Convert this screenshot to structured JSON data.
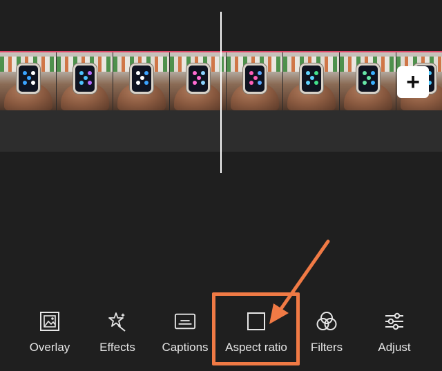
{
  "timeline": {
    "frames": [
      {
        "dots": [
          "#3aa3ff",
          "#ffffff"
        ]
      },
      {
        "dots": [
          "#4cc3ff",
          "#b56cff"
        ]
      },
      {
        "dots": [
          "#ffffff",
          "#3aa3ff"
        ]
      },
      {
        "dots": [
          "#ff6bd3",
          "#8ad2ff"
        ]
      },
      {
        "dots": [
          "#ff5fb8",
          "#5aa8ff"
        ]
      },
      {
        "dots": [
          "#5fd3ff",
          "#42e08a"
        ]
      },
      {
        "dots": [
          "#66e6a7",
          "#3bb0ff"
        ]
      },
      {
        "dots": [
          "#ff6be0",
          "#49c8ff"
        ]
      }
    ],
    "add_button": "+"
  },
  "toolbar": {
    "items": [
      {
        "id": "overlay",
        "label": "Overlay",
        "icon": "overlay-icon"
      },
      {
        "id": "effects",
        "label": "Effects",
        "icon": "effects-icon"
      },
      {
        "id": "captions",
        "label": "Captions",
        "icon": "captions-icon"
      },
      {
        "id": "aspect-ratio",
        "label": "Aspect ratio",
        "icon": "aspect-ratio-icon"
      },
      {
        "id": "filters",
        "label": "Filters",
        "icon": "filters-icon"
      },
      {
        "id": "adjust",
        "label": "Adjust",
        "icon": "adjust-icon"
      }
    ]
  },
  "colors": {
    "background": "#1f1f1f",
    "timeline_border": "#e04b6a",
    "annotation": "#f07a45"
  }
}
